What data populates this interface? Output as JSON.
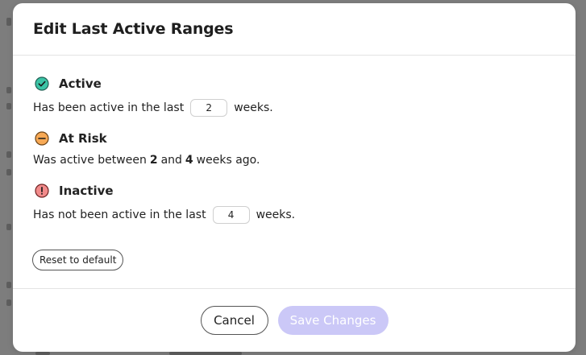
{
  "modal": {
    "title": "Edit Last Active Ranges"
  },
  "ranges": {
    "active": {
      "label": "Active",
      "icon": "check-circle-icon",
      "color": "#2bb59a",
      "text_before": "Has been active in the last",
      "weeks_value": "2",
      "text_after": "weeks."
    },
    "at_risk": {
      "label": "At Risk",
      "icon": "minus-circle-icon",
      "color": "#f4a24b",
      "text_before": "Was active between",
      "from_value": "2",
      "text_middle": "and",
      "to_value": "4",
      "text_after": "weeks ago."
    },
    "inactive": {
      "label": "Inactive",
      "icon": "exclamation-circle-icon",
      "color": "#e2524f",
      "text_before": "Has not been active in the last",
      "weeks_value": "4",
      "text_after": "weeks."
    }
  },
  "actions": {
    "reset_label": "Reset to default",
    "cancel_label": "Cancel",
    "save_label": "Save Changes",
    "save_color": "#cbc8f7"
  }
}
